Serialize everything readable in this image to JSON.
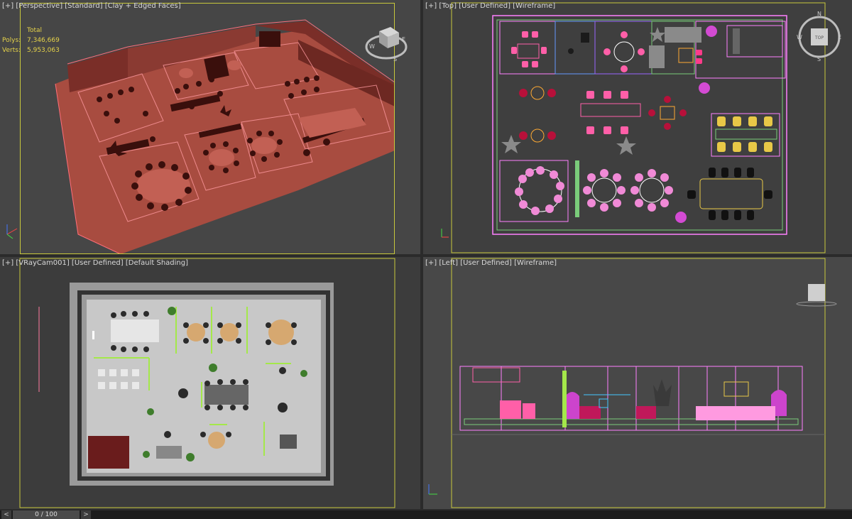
{
  "viewports": {
    "perspective": {
      "label_parts": [
        "[+]",
        "[Perspective]",
        "[Standard]",
        "[Clay + Edged Faces]"
      ]
    },
    "top": {
      "label_parts": [
        "[+]",
        "[Top]",
        "[User Defined]",
        "[Wireframe]"
      ]
    },
    "camera": {
      "label_parts": [
        "[+]",
        "[VRayCam001]",
        "[User Defined]",
        "[Default Shading]"
      ]
    },
    "left": {
      "label_parts": [
        "[+]",
        "[Left]",
        "[User Defined]",
        "[Wireframe]"
      ]
    }
  },
  "stats": {
    "title": "Total",
    "polys_label": "Polys:",
    "polys_value": "7,346,669",
    "verts_label": "Verts:",
    "verts_value": "5,953,063"
  },
  "viewcube": {
    "top_face": "TOP",
    "north": "N",
    "south": "S",
    "east": "E",
    "west": "W"
  },
  "timeline": {
    "frame_readout": "0 / 100",
    "next_label": ">",
    "prev_label": "<"
  },
  "colors": {
    "active_border": "#c8c83c",
    "viewport_bg": "#444444",
    "clay": "#b8594c",
    "stats_text": "#e5d24a"
  }
}
